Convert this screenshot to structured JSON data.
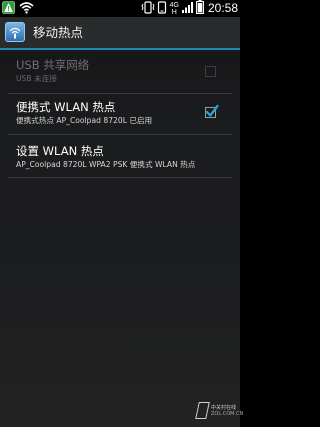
{
  "status_bar": {
    "time": "20:58",
    "network_type": "4G",
    "network_sub": "H",
    "left_icons": [
      "warning-icon",
      "wifi-hotspot-icon"
    ],
    "right_icons": [
      "vibrate-icon",
      "signal-4g-icon",
      "signal-bars-icon",
      "battery-icon"
    ]
  },
  "action_bar": {
    "icon": "hotspot-settings-icon",
    "title": "移动热点"
  },
  "preferences": [
    {
      "title": "USB 共享网络",
      "summary": "USB 未连接",
      "enabled": false,
      "checked": false
    },
    {
      "title": "便携式 WLAN 热点",
      "summary": "便携式热点 AP_Coolpad 8720L 已启用",
      "enabled": true,
      "checked": true
    },
    {
      "title": "设置 WLAN 热点",
      "summary": "AP_Coolpad 8720L WPA2 PSK 便携式 WLAN 热点",
      "enabled": true,
      "checked": null
    }
  ],
  "watermark": {
    "line1": "中关村在线",
    "line2": "ZOL.COM.CN"
  },
  "colors": {
    "accent": "#1f86b6",
    "check": "#2aa2d8",
    "background": "#1c1d1f",
    "actionbar": "#2a2b2d"
  }
}
